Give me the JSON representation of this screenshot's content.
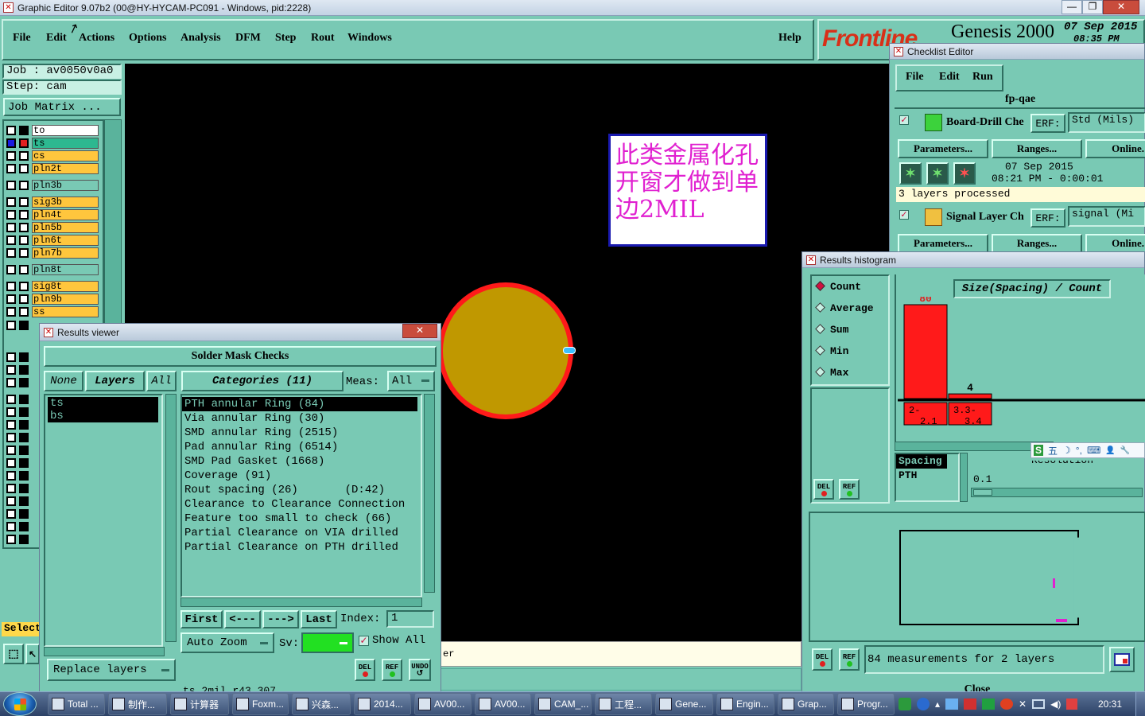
{
  "window": {
    "title": "Graphic Editor 9.07b2 (00@HY-HYCAM-PC091 - Windows, pid:2228)",
    "controls": [
      "—",
      "❐",
      "✕"
    ]
  },
  "menubar": {
    "items": [
      "File",
      "Edit",
      "Actions",
      "Options",
      "Analysis",
      "DFM",
      "Step",
      "Rout",
      "Windows"
    ],
    "help": "Help"
  },
  "brand": {
    "logo": "Frontline",
    "product": "Genesis 2000",
    "date": "07 Sep 2015",
    "time": "08:35 PM"
  },
  "job_panel": {
    "job": "Job : av0050v0a0",
    "step": "Step: cam",
    "job_matrix": "Job Matrix ..."
  },
  "layers": [
    {
      "name": "to",
      "color": "#ffffff"
    },
    {
      "name": "ts",
      "color": "#2db890"
    },
    {
      "name": "cs",
      "color": "#ffc63d"
    },
    {
      "name": "pln2t",
      "color": "#ffc63d"
    },
    {
      "name": "pln3b",
      "color": "#79c9b4"
    },
    {
      "name": "sig3b",
      "color": "#ffc63d"
    },
    {
      "name": "pln4t",
      "color": "#ffc63d"
    },
    {
      "name": "pln5b",
      "color": "#ffc63d"
    },
    {
      "name": "pln6t",
      "color": "#ffc63d"
    },
    {
      "name": "pln7b",
      "color": "#ffc63d"
    },
    {
      "name": "pln8t",
      "color": "#79c9b4"
    },
    {
      "name": "sig8t",
      "color": "#ffc63d"
    },
    {
      "name": "pln9b",
      "color": "#ffc63d"
    },
    {
      "name": "ss",
      "color": "#ffc63d"
    }
  ],
  "left_panel": {
    "select_label": "Select"
  },
  "canvas": {
    "annotation": "此类金属化孔开窗才做到单边2MIL",
    "status_fragment": "er"
  },
  "results_viewer": {
    "title": "Results viewer",
    "header": "Solder Mask Checks",
    "none_btn": "None",
    "layers_btn": "Layers",
    "all_btn": "All",
    "categories_btn": "Categories (11)",
    "meas_label": "Meas:",
    "meas_value": "All",
    "layer_list": [
      "ts",
      "bs"
    ],
    "categories": [
      "PTH annular Ring (84)",
      "Via annular Ring (30)",
      "SMD annular Ring (2515)",
      "Pad annular Ring (6514)",
      "SMD Pad Gasket (1668)",
      "Coverage (91)",
      "Rout spacing (26)       (D:42)",
      "Clearance to Clearance Connection",
      "Feature too small to check (66)",
      "Partial Clearance on VIA drilled",
      "Partial Clearance on PTH drilled"
    ],
    "first_btn": "First",
    "prev_btn": "<---",
    "next_btn": "--->",
    "last_btn": "Last",
    "index_label": "Index:",
    "index_value": "1",
    "autozoom_btn": "Auto Zoom",
    "sv_label": "Sv:",
    "show_all": "Show All",
    "replace_layers_btn": "Replace layers",
    "del_btn": "DEL",
    "ref_btn": "REF",
    "undo_btn": "UNDO",
    "footer_text": "ts 2mil  r43.307"
  },
  "checklist_editor": {
    "title": "Checklist Editor",
    "menu": [
      "File",
      "Edit",
      "Run"
    ],
    "checklist_name": "fp-qae",
    "checks": [
      {
        "name": "Board-Drill Che",
        "erf_label": "ERF:",
        "erf_value": "Std (Mils)",
        "parameters": "Parameters...",
        "ranges": "Ranges...",
        "online": "Online.",
        "date": "07 Sep 2015",
        "time_line": "08:21 PM - 0:00:01",
        "status": "3 layers processed"
      },
      {
        "name": "Signal Layer Ch",
        "erf_label": "ERF:",
        "erf_value": "signal (Mi",
        "parameters": "Parameters...",
        "ranges": "Ranges...",
        "online": "Online."
      }
    ]
  },
  "histogram": {
    "title": "Results histogram",
    "options": [
      "Count",
      "Average",
      "Sum",
      "Min",
      "Max"
    ],
    "selected_option": "Count",
    "chart_title": "Size(Spacing) / Count",
    "bins": [
      {
        "label_top": "2-",
        "label_bottom": "2.1",
        "count": 80
      },
      {
        "label_top": "3.3-",
        "label_bottom": "3.4",
        "count": 4
      }
    ],
    "field_list": [
      "Spacing",
      "PTH"
    ],
    "resolution_label": "Resolution",
    "resolution_value": "0.1",
    "measurements": "84 measurements for 2 layers",
    "close": "Close",
    "del_btn": "DEL",
    "ref_btn": "REF"
  },
  "ime_bar": {
    "items": [
      "S",
      "五",
      "☽",
      "°,",
      "⌨",
      "👤",
      "🔧"
    ]
  },
  "taskbar": {
    "items": [
      "Total ...",
      "制作...",
      "计算器",
      "Foxm...",
      "兴森...",
      "2014...",
      "AV00...",
      "AV00...",
      "CAM_...",
      "工程...",
      "Gene...",
      "Engin...",
      "Grap...",
      "Progr..."
    ],
    "clock": "20:31"
  },
  "colors": {
    "panel": "#79c9b4",
    "canvas": "#000000",
    "pad_fill": "#c09800",
    "pad_ring": "#ff1a1a",
    "annotation_text": "#e020d0",
    "histogram_bar": "#ff1a1a",
    "layer_active": "#ffc63d"
  }
}
